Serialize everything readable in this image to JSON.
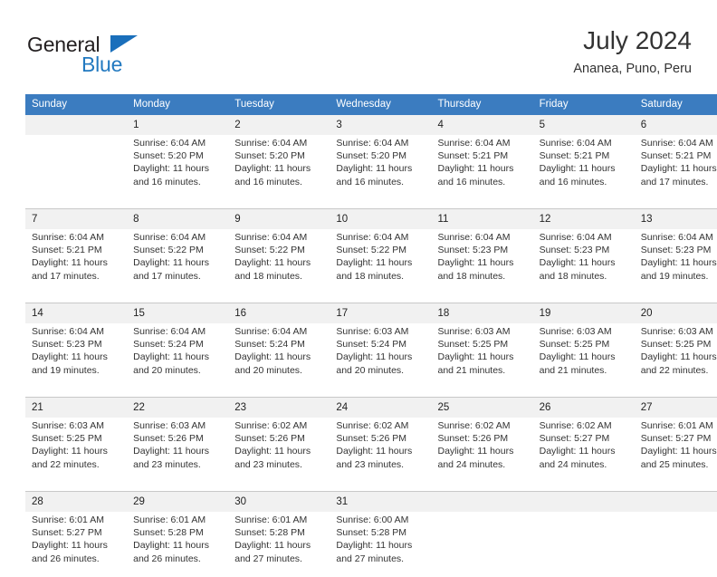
{
  "brand": {
    "name_top": "General",
    "name_bottom": "Blue",
    "triangle_icon": "triangle-logo-mark",
    "color_dark": "#231f20",
    "color_blue": "#2279c0"
  },
  "header": {
    "month_title": "July 2024",
    "location": "Ananea, Puno, Peru"
  },
  "theme": {
    "header_blue": "#3b7cc0",
    "daynum_band": "#f1f1f1",
    "rule": "#c8c8c8",
    "text": "#333333"
  },
  "calendar": {
    "weekday_headers": [
      "Sunday",
      "Monday",
      "Tuesday",
      "Wednesday",
      "Thursday",
      "Friday",
      "Saturday"
    ],
    "weeks": [
      {
        "days": [
          {
            "num": "",
            "empty": true,
            "lines": []
          },
          {
            "num": "1",
            "empty": false,
            "lines": [
              "Sunrise: 6:04 AM",
              "Sunset: 5:20 PM",
              "Daylight: 11 hours",
              "and 16 minutes."
            ]
          },
          {
            "num": "2",
            "empty": false,
            "lines": [
              "Sunrise: 6:04 AM",
              "Sunset: 5:20 PM",
              "Daylight: 11 hours",
              "and 16 minutes."
            ]
          },
          {
            "num": "3",
            "empty": false,
            "lines": [
              "Sunrise: 6:04 AM",
              "Sunset: 5:20 PM",
              "Daylight: 11 hours",
              "and 16 minutes."
            ]
          },
          {
            "num": "4",
            "empty": false,
            "lines": [
              "Sunrise: 6:04 AM",
              "Sunset: 5:21 PM",
              "Daylight: 11 hours",
              "and 16 minutes."
            ]
          },
          {
            "num": "5",
            "empty": false,
            "lines": [
              "Sunrise: 6:04 AM",
              "Sunset: 5:21 PM",
              "Daylight: 11 hours",
              "and 16 minutes."
            ]
          },
          {
            "num": "6",
            "empty": false,
            "lines": [
              "Sunrise: 6:04 AM",
              "Sunset: 5:21 PM",
              "Daylight: 11 hours",
              "and 17 minutes."
            ]
          }
        ]
      },
      {
        "days": [
          {
            "num": "7",
            "empty": false,
            "lines": [
              "Sunrise: 6:04 AM",
              "Sunset: 5:21 PM",
              "Daylight: 11 hours",
              "and 17 minutes."
            ]
          },
          {
            "num": "8",
            "empty": false,
            "lines": [
              "Sunrise: 6:04 AM",
              "Sunset: 5:22 PM",
              "Daylight: 11 hours",
              "and 17 minutes."
            ]
          },
          {
            "num": "9",
            "empty": false,
            "lines": [
              "Sunrise: 6:04 AM",
              "Sunset: 5:22 PM",
              "Daylight: 11 hours",
              "and 18 minutes."
            ]
          },
          {
            "num": "10",
            "empty": false,
            "lines": [
              "Sunrise: 6:04 AM",
              "Sunset: 5:22 PM",
              "Daylight: 11 hours",
              "and 18 minutes."
            ]
          },
          {
            "num": "11",
            "empty": false,
            "lines": [
              "Sunrise: 6:04 AM",
              "Sunset: 5:23 PM",
              "Daylight: 11 hours",
              "and 18 minutes."
            ]
          },
          {
            "num": "12",
            "empty": false,
            "lines": [
              "Sunrise: 6:04 AM",
              "Sunset: 5:23 PM",
              "Daylight: 11 hours",
              "and 18 minutes."
            ]
          },
          {
            "num": "13",
            "empty": false,
            "lines": [
              "Sunrise: 6:04 AM",
              "Sunset: 5:23 PM",
              "Daylight: 11 hours",
              "and 19 minutes."
            ]
          }
        ]
      },
      {
        "days": [
          {
            "num": "14",
            "empty": false,
            "lines": [
              "Sunrise: 6:04 AM",
              "Sunset: 5:23 PM",
              "Daylight: 11 hours",
              "and 19 minutes."
            ]
          },
          {
            "num": "15",
            "empty": false,
            "lines": [
              "Sunrise: 6:04 AM",
              "Sunset: 5:24 PM",
              "Daylight: 11 hours",
              "and 20 minutes."
            ]
          },
          {
            "num": "16",
            "empty": false,
            "lines": [
              "Sunrise: 6:04 AM",
              "Sunset: 5:24 PM",
              "Daylight: 11 hours",
              "and 20 minutes."
            ]
          },
          {
            "num": "17",
            "empty": false,
            "lines": [
              "Sunrise: 6:03 AM",
              "Sunset: 5:24 PM",
              "Daylight: 11 hours",
              "and 20 minutes."
            ]
          },
          {
            "num": "18",
            "empty": false,
            "lines": [
              "Sunrise: 6:03 AM",
              "Sunset: 5:25 PM",
              "Daylight: 11 hours",
              "and 21 minutes."
            ]
          },
          {
            "num": "19",
            "empty": false,
            "lines": [
              "Sunrise: 6:03 AM",
              "Sunset: 5:25 PM",
              "Daylight: 11 hours",
              "and 21 minutes."
            ]
          },
          {
            "num": "20",
            "empty": false,
            "lines": [
              "Sunrise: 6:03 AM",
              "Sunset: 5:25 PM",
              "Daylight: 11 hours",
              "and 22 minutes."
            ]
          }
        ]
      },
      {
        "days": [
          {
            "num": "21",
            "empty": false,
            "lines": [
              "Sunrise: 6:03 AM",
              "Sunset: 5:25 PM",
              "Daylight: 11 hours",
              "and 22 minutes."
            ]
          },
          {
            "num": "22",
            "empty": false,
            "lines": [
              "Sunrise: 6:03 AM",
              "Sunset: 5:26 PM",
              "Daylight: 11 hours",
              "and 23 minutes."
            ]
          },
          {
            "num": "23",
            "empty": false,
            "lines": [
              "Sunrise: 6:02 AM",
              "Sunset: 5:26 PM",
              "Daylight: 11 hours",
              "and 23 minutes."
            ]
          },
          {
            "num": "24",
            "empty": false,
            "lines": [
              "Sunrise: 6:02 AM",
              "Sunset: 5:26 PM",
              "Daylight: 11 hours",
              "and 23 minutes."
            ]
          },
          {
            "num": "25",
            "empty": false,
            "lines": [
              "Sunrise: 6:02 AM",
              "Sunset: 5:26 PM",
              "Daylight: 11 hours",
              "and 24 minutes."
            ]
          },
          {
            "num": "26",
            "empty": false,
            "lines": [
              "Sunrise: 6:02 AM",
              "Sunset: 5:27 PM",
              "Daylight: 11 hours",
              "and 24 minutes."
            ]
          },
          {
            "num": "27",
            "empty": false,
            "lines": [
              "Sunrise: 6:01 AM",
              "Sunset: 5:27 PM",
              "Daylight: 11 hours",
              "and 25 minutes."
            ]
          }
        ]
      },
      {
        "days": [
          {
            "num": "28",
            "empty": false,
            "lines": [
              "Sunrise: 6:01 AM",
              "Sunset: 5:27 PM",
              "Daylight: 11 hours",
              "and 26 minutes."
            ]
          },
          {
            "num": "29",
            "empty": false,
            "lines": [
              "Sunrise: 6:01 AM",
              "Sunset: 5:28 PM",
              "Daylight: 11 hours",
              "and 26 minutes."
            ]
          },
          {
            "num": "30",
            "empty": false,
            "lines": [
              "Sunrise: 6:01 AM",
              "Sunset: 5:28 PM",
              "Daylight: 11 hours",
              "and 27 minutes."
            ]
          },
          {
            "num": "31",
            "empty": false,
            "lines": [
              "Sunrise: 6:00 AM",
              "Sunset: 5:28 PM",
              "Daylight: 11 hours",
              "and 27 minutes."
            ]
          },
          {
            "num": "",
            "empty": true,
            "lines": []
          },
          {
            "num": "",
            "empty": true,
            "lines": []
          },
          {
            "num": "",
            "empty": true,
            "lines": []
          }
        ]
      }
    ]
  }
}
